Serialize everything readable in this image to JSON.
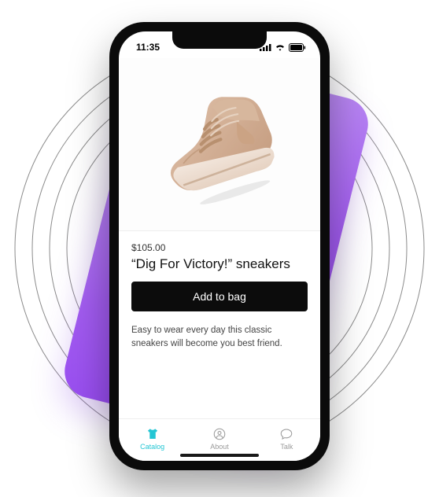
{
  "decor": {
    "tile_gradient_from": "#c9a6f5",
    "tile_gradient_to": "#8e3df0"
  },
  "status": {
    "time": "11:35",
    "icons": {
      "signal": "signal-icon",
      "wifi": "wifi-icon",
      "battery": "battery-icon"
    }
  },
  "product": {
    "price": "$105.00",
    "title": "“Dig For Victory!” sneakers",
    "button_label": "Add to bag",
    "description": "Easy to wear every day this classic sneakers will become you best friend.",
    "image_semantic": "sneaker-image"
  },
  "tabs": [
    {
      "id": "catalog",
      "label": "Catalog",
      "active": true
    },
    {
      "id": "about",
      "label": "About",
      "active": false
    },
    {
      "id": "talk",
      "label": "Talk",
      "active": false
    }
  ]
}
